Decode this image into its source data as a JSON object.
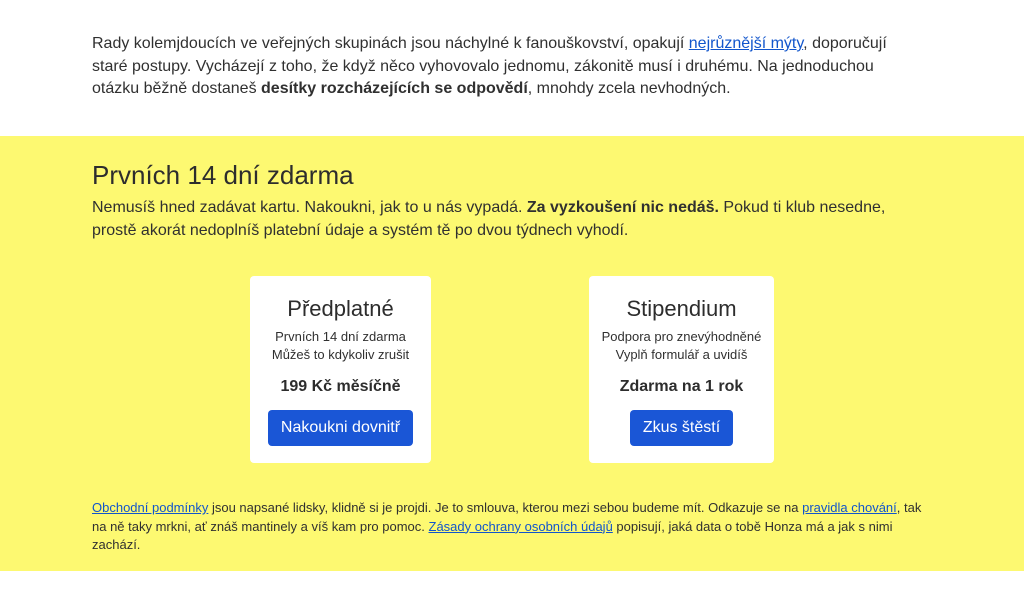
{
  "intro": {
    "part1": "Rady kolemjdoucích ve veřejných skupinách jsou náchylné k fanouškovství, opakují ",
    "link_myths": "nejrůznější mýty",
    "part2": ", doporučují staré postupy. Vycházejí z toho, že když něco vyhovovalo jednomu, zákonitě musí i druhému. Na jednoduchou otázku běžně dostaneš ",
    "bold": "desítky rozcházejících se odpovědí",
    "part3": ", mnohdy zcela nevhodných."
  },
  "promo": {
    "title": "Prvních 14 dní zdarma",
    "text_part1": "Nemusíš hned zadávat kartu. Nakoukni, jak to u nás vypadá. ",
    "text_bold": "Za vyzkoušení nic nedáš.",
    "text_part2": " Pokud ti klub nesedne, prostě akorát nedoplníš platební údaje a systém tě po dvou týdnech vyhodí.",
    "background_color": "#fdf971"
  },
  "cards": [
    {
      "title": "Předplatné",
      "line1": "Prvních 14 dní zdarma",
      "line2": "Můžeš to kdykoliv zrušit",
      "price": "199 Kč měsíčně",
      "button": "Nakoukni dovnitř"
    },
    {
      "title": "Stipendium",
      "line1": "Podpora pro znevýhodněné",
      "line2": "Vyplň formulář a uvidíš",
      "price": "Zdarma na 1 rok",
      "button": "Zkus štěstí"
    }
  ],
  "terms": {
    "link_terms": "Obchodní podmínky",
    "part1": " jsou napsané lidsky, klidně si je projdi. Je to smlouva, kterou mezi sebou budeme mít. Odkazuje se na ",
    "link_rules": "pravidla chování",
    "part2": ", tak na ně taky mrkni, ať znáš mantinely a víš kam pro pomoc. ",
    "link_privacy": "Zásady ochrany osobních údajů",
    "part3": " popisují, jaká data o tobě Honza má a jak s nimi zachází."
  },
  "colors": {
    "button": "#1a56d6",
    "link": "#1155cc"
  }
}
